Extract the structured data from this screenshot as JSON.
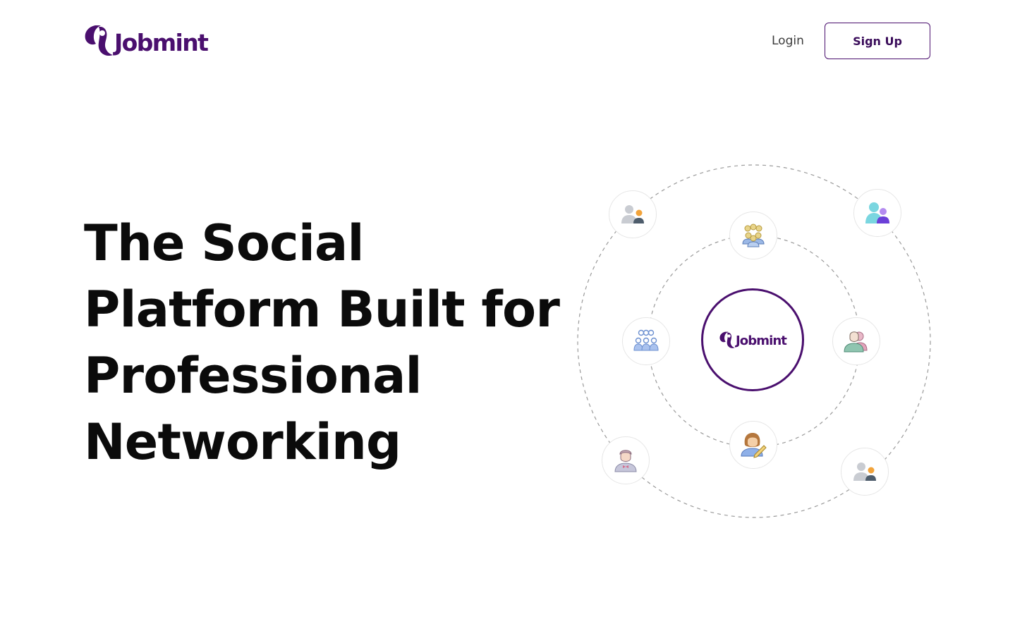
{
  "header": {
    "brand": "Jobmint",
    "login_label": "Login",
    "signup_label": "Sign Up"
  },
  "hero": {
    "title_lines": [
      "The Social",
      "Platform Built for",
      "Professional",
      "Networking"
    ]
  },
  "network": {
    "center_brand": "Jobmint",
    "nodes": [
      "user-with-badge-icon",
      "crowd-icon",
      "two-users-icon",
      "group-icon",
      "users-icon",
      "person-with-bowtie-icon",
      "woman-writing-icon",
      "user-with-badge-icon"
    ]
  },
  "colors": {
    "brand": "#4a0f6e",
    "text": "#0b0b0b",
    "muted": "#3b3b3b"
  }
}
